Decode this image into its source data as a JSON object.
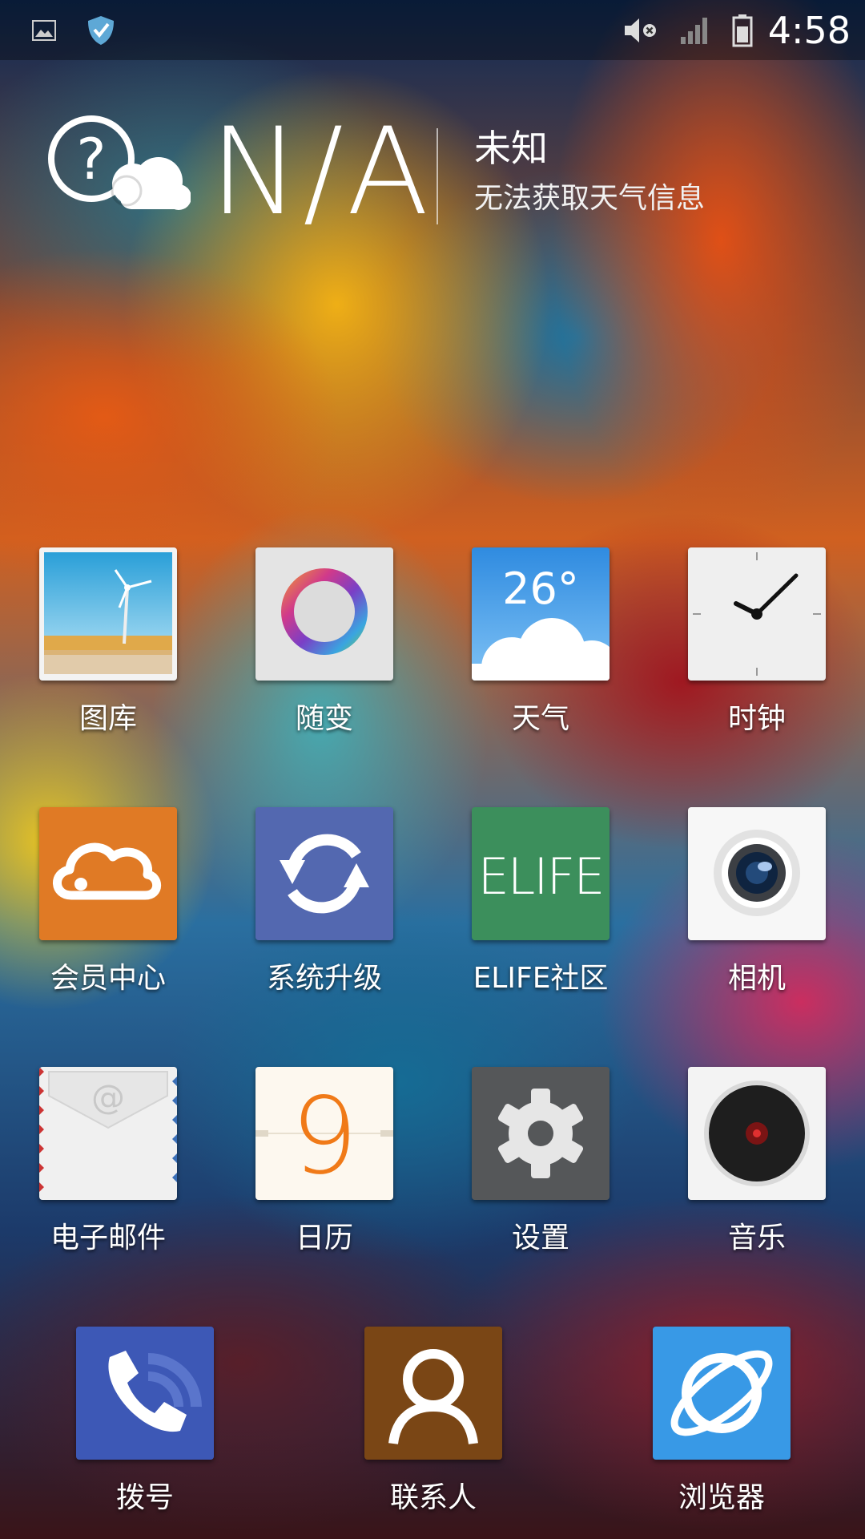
{
  "status_bar": {
    "time": "4:58",
    "icons": [
      "gallery-notification-icon",
      "shield-notification-icon",
      "mute-icon",
      "signal-icon",
      "battery-icon"
    ]
  },
  "weather": {
    "temperature": "N/A",
    "city": "未知",
    "description": "无法获取天气信息",
    "icon": "unknown-weather-icon"
  },
  "apps": [
    {
      "label": "图库",
      "icon": "gallery-icon"
    },
    {
      "label": "随变",
      "icon": "theme-ring-icon"
    },
    {
      "label": "天气",
      "icon": "weather-app-icon",
      "badge": "26°"
    },
    {
      "label": "时钟",
      "icon": "clock-icon"
    },
    {
      "label": "会员中心",
      "icon": "cloud-member-icon"
    },
    {
      "label": "系统升级",
      "icon": "update-sync-icon"
    },
    {
      "label": "ELIFE社区",
      "icon": "elife-icon",
      "badge": "ELIFE"
    },
    {
      "label": "相机",
      "icon": "camera-icon"
    },
    {
      "label": "电子邮件",
      "icon": "mail-envelope-icon"
    },
    {
      "label": "日历",
      "icon": "calendar-icon",
      "badge": "9"
    },
    {
      "label": "设置",
      "icon": "gear-icon"
    },
    {
      "label": "音乐",
      "icon": "music-disc-icon"
    }
  ],
  "dock": [
    {
      "label": "拨号",
      "icon": "phone-icon"
    },
    {
      "label": "联系人",
      "icon": "contacts-icon"
    },
    {
      "label": "浏览器",
      "icon": "browser-globe-icon"
    }
  ],
  "colors": {
    "member_orange": "#e07a25",
    "update_blue": "#5368b0",
    "elife_green": "#3c8f5c",
    "settings_gray": "#555759",
    "phone_blue": "#3d58b6",
    "contacts_brown": "#7a4615",
    "browser_blue": "#3899e6"
  }
}
